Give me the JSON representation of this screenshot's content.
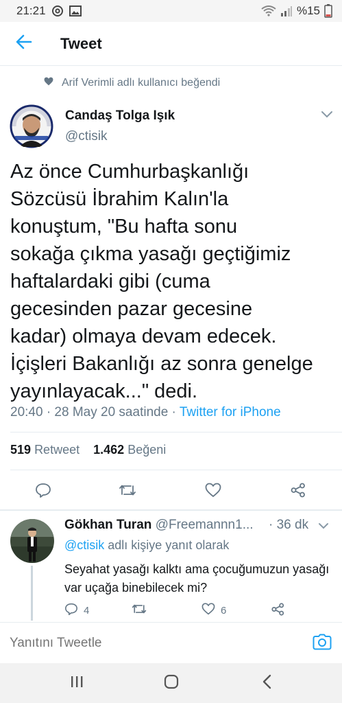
{
  "status_bar": {
    "time": "21:21",
    "battery": "%15"
  },
  "header": {
    "title": "Tweet"
  },
  "social_context": {
    "text": "Arif Verimli adlı kullanıcı beğendi"
  },
  "tweet": {
    "author_name": "Candaş Tolga Işık",
    "author_handle": "@ctisik",
    "text_lines": [
      "Az önce Cumhurbaşkanlığı",
      "Sözcüsü İbrahim Kalın'la",
      "konuştum, \"Bu hafta sonu",
      "sokağa çıkma yasağı geçtiğimiz",
      "haftalardaki gibi (cuma",
      "gecesinden pazar gecesine",
      "kadar) olmaya devam edecek.",
      "İçişleri Bakanlığı az sonra genelge",
      "yayınlayacak...\" dedi."
    ],
    "timestamp": "20:40 · 28 May 20 saatinde · ",
    "source": "Twitter for iPhone",
    "retweet_count": "519",
    "retweet_label": "Retweet",
    "like_count": "1.462",
    "like_label": "Beğeni"
  },
  "reply": {
    "author_name": "Gökhan Turan",
    "author_handle": "@Freemannn1...",
    "time": "· 36 dk",
    "reply_to_mention": "@ctisik",
    "reply_to_suffix": " adlı kişiye yanıt olarak",
    "text": "Seyahat yasağı kalktı ama çocuğumuzun yasağı var uçağa binebilecek mi?",
    "reply_count": "4",
    "like_count": "6"
  },
  "composer": {
    "placeholder": "Yanıtını Tweetle"
  },
  "colors": {
    "accent": "#1da1f2",
    "secondary_text": "#657786",
    "primary_text": "#14171a"
  }
}
